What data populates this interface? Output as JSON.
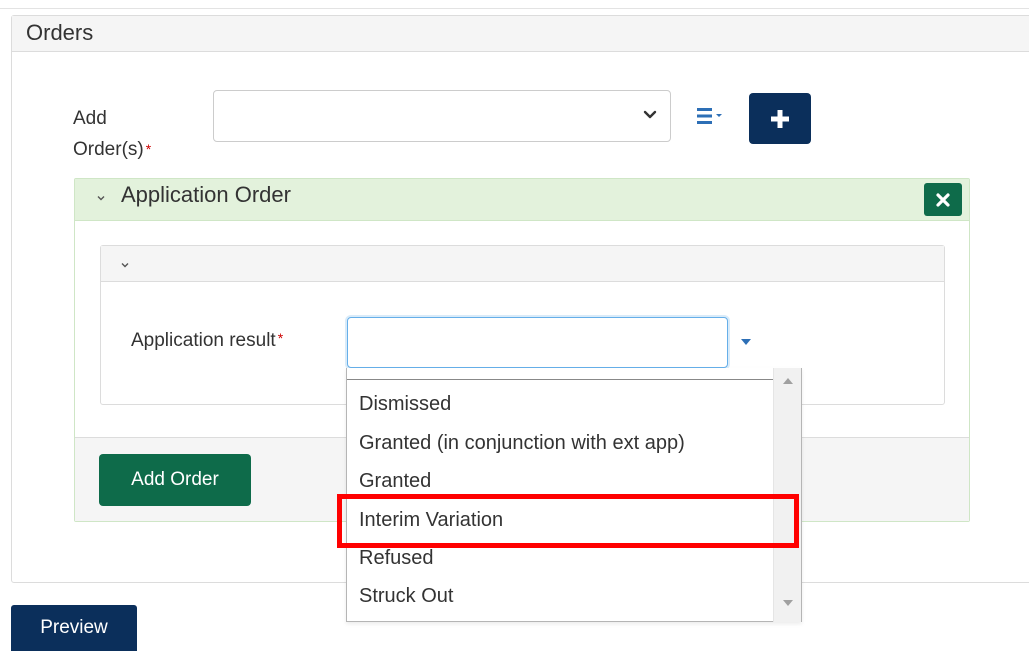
{
  "orders": {
    "title": "Orders",
    "add_label_line1": "Add",
    "add_label_line2": "Order(s)",
    "required_mark": "*",
    "select_value": ""
  },
  "application_order": {
    "title": "Application Order",
    "application_result_label": "Application result",
    "application_result_value": "",
    "add_order_label": "Add Order"
  },
  "dropdown": {
    "options": [
      "Dismissed",
      "Granted (in conjunction with ext app)",
      "Granted",
      "Interim Variation",
      "Refused",
      "Struck Out"
    ],
    "highlighted_option": "Interim Variation"
  },
  "footer": {
    "preview_label": "Preview"
  },
  "colors": {
    "navy": "#0b2f5b",
    "green": "#0e6b4a",
    "light_green_header": "#e3f2dc",
    "highlight_red": "#ff0000",
    "required_red": "#cc0000"
  }
}
